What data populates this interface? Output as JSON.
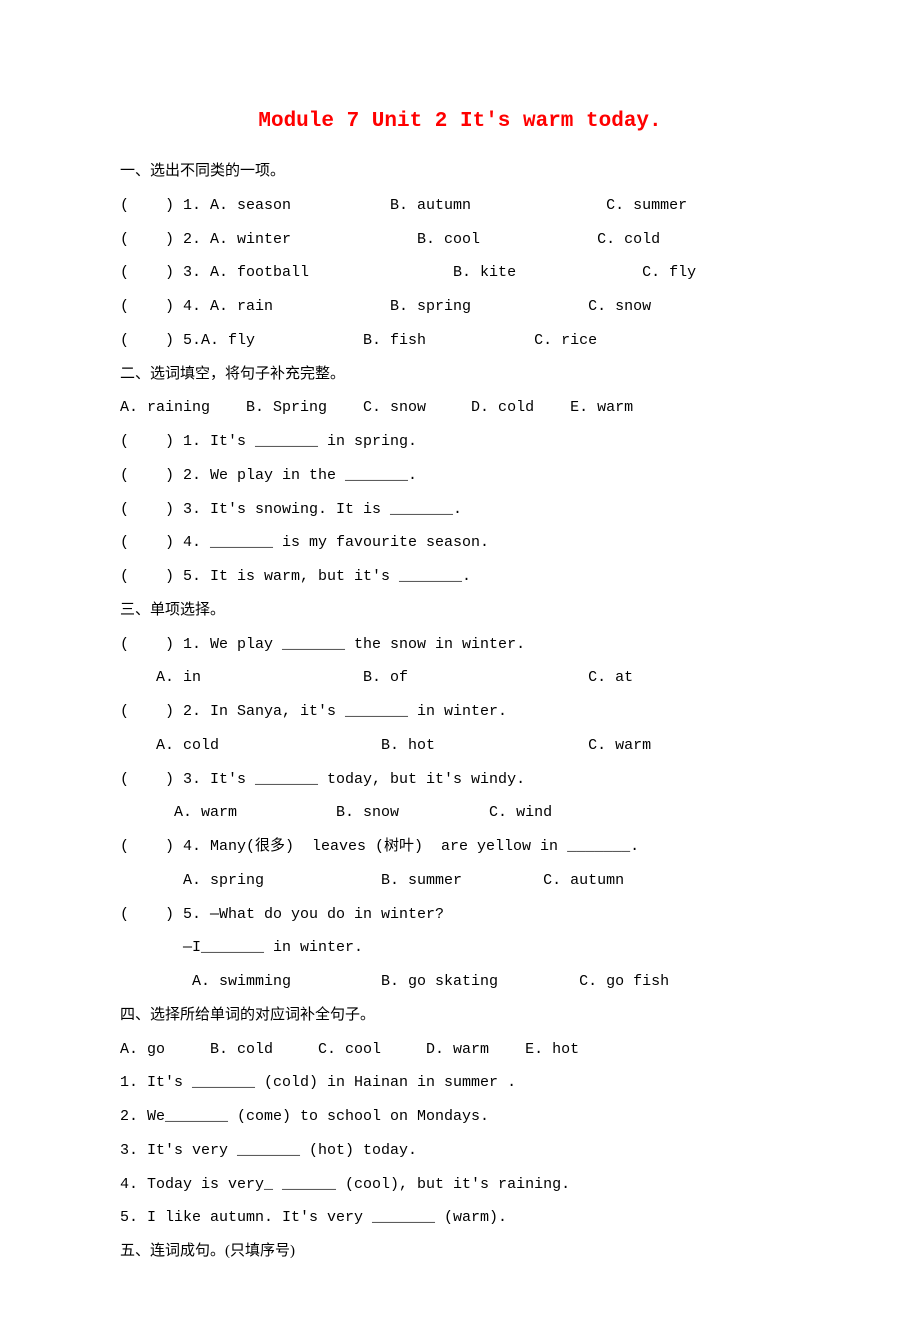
{
  "title": "Module 7 Unit 2 It's warm today.",
  "sections": {
    "s1": {
      "heading": "一、选出不同类的一项。",
      "q1": "(    ) 1. A. season           B. autumn               C. summer",
      "q2": "(    ) 2. A. winter              B. cool             C. cold",
      "q3": "(    ) 3. A. football                B. kite              C. fly",
      "q4": "(    ) 4. A. rain             B. spring             C. snow",
      "q5": "(    ) 5.A. fly            B. fish            C. rice"
    },
    "s2": {
      "heading": "二、选词填空，将句子补充完整。",
      "options": "A. raining    B. Spring    C. snow     D. cold    E. warm",
      "q1": "(    ) 1. It's _______ in spring.",
      "q2": "(    ) 2. We play in the _______.",
      "q3": "(    ) 3. It's snowing. It is _______.",
      "q4": "(    ) 4. _______ is my favourite season.",
      "q5": "(    ) 5. It is warm, but it's _______."
    },
    "s3": {
      "heading": "三、单项选择。",
      "q1": "(    ) 1. We play _______ the snow in winter.",
      "q1o": "    A. in                  B. of                    C. at",
      "q2": "(    ) 2. In Sanya, it's _______ in winter.",
      "q2o": "    A. cold                  B. hot                 C. warm",
      "q3": "(    ) 3. It's _______ today, but it's windy.",
      "q3o": "      A. warm           B. snow          C. wind",
      "q4": "(    ) 4. Many(很多)  leaves (树叶)  are yellow in _______.",
      "q4o": "       A. spring             B. summer         C. autumn",
      "q5": "(    ) 5. —What do you do in winter?",
      "q5b": "       —I_______ in winter.",
      "q5o": "        A. swimming          B. go skating         C. go fish"
    },
    "s4": {
      "heading": "四、选择所给单词的对应词补全句子。",
      "options": "A. go     B. cold     C. cool     D. warm    E. hot",
      "q1": "1. It's _______ (cold) in Hainan in summer .",
      "q2": "2. We_______ (come) to school on Mondays.",
      "q3": "3. It's very _______ (hot) today.",
      "q4": "4. Today is very_ ______ (cool), but it's raining.",
      "q5": "5. I like autumn. It's very _______ (warm)."
    },
    "s5": {
      "heading": "五、连词成句。(只填序号)"
    }
  }
}
